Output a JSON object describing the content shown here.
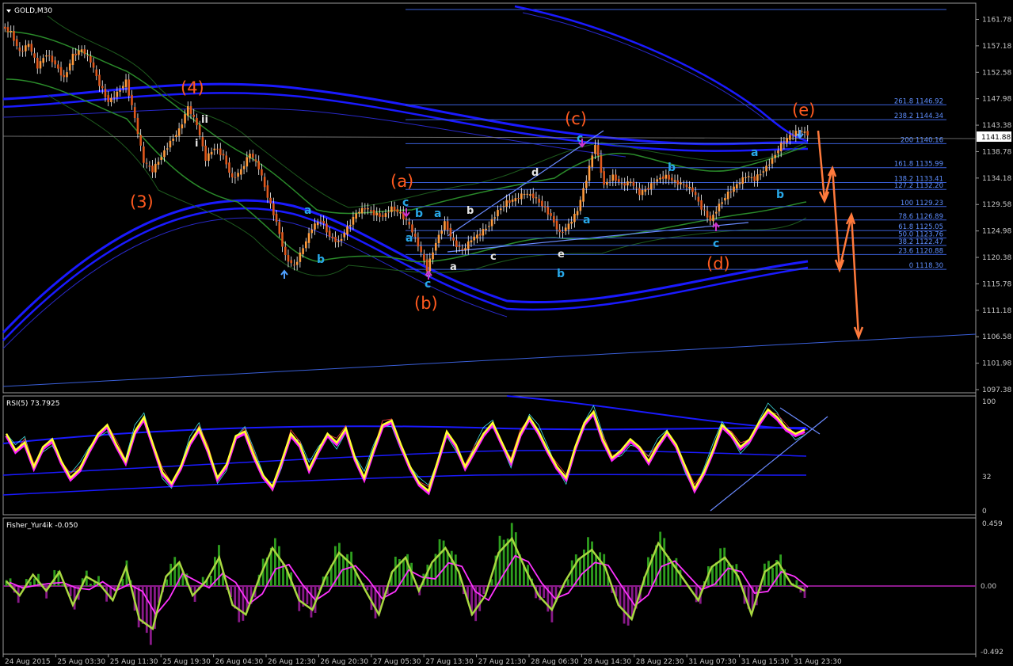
{
  "window": {
    "title": "GOLD,M30"
  },
  "indicators": {
    "rsi_title": "RSI(5) 73.7925",
    "fisher_title": "Fisher_Yur4ik -0.050"
  },
  "price_scale": [
    "1161.78",
    "1157.18",
    "1152.58",
    "1147.98",
    "1143.38",
    "1138.78",
    "1134.18",
    "1129.58",
    "1124.98",
    "1120.38",
    "1115.78",
    "1111.18",
    "1106.58",
    "1101.98",
    "1097.38"
  ],
  "current_price": "1141.88",
  "rsi_scale": [
    "100",
    "32",
    "0"
  ],
  "fisher_scale": [
    "0.459",
    "0.00",
    "-0.492"
  ],
  "time_axis": [
    "24 Aug 2015",
    "25 Aug 03:30",
    "25 Aug 11:30",
    "25 Aug 19:30",
    "26 Aug 04:30",
    "26 Aug 12:30",
    "26 Aug 20:30",
    "27 Aug 05:30",
    "27 Aug 13:30",
    "27 Aug 21:30",
    "28 Aug 06:30",
    "28 Aug 14:30",
    "28 Aug 22:30",
    "31 Aug 07:30",
    "31 Aug 15:30",
    "31 Aug 23:30"
  ],
  "fib_levels": [
    {
      "label": "261.8 1146.92",
      "price": 1146.92
    },
    {
      "label": "238.2 1144.34",
      "price": 1144.34
    },
    {
      "label": "200 1140.16",
      "price": 1140.16
    },
    {
      "label": "161.8 1135.99",
      "price": 1135.99
    },
    {
      "label": "138.2 1133.41",
      "price": 1133.41
    },
    {
      "label": "127.2 1132.20",
      "price": 1132.2
    },
    {
      "label": "100 1129.23",
      "price": 1129.23
    },
    {
      "label": "78.6 1126.89",
      "price": 1126.89
    },
    {
      "label": "61.8 1125.05",
      "price": 1125.05
    },
    {
      "label": "50.0 1123.76",
      "price": 1123.76
    },
    {
      "label": "38.2 1122.47",
      "price": 1122.47
    },
    {
      "label": "23.6 1120.88",
      "price": 1120.88
    },
    {
      "label": "0 1118.30",
      "price": 1118.3
    }
  ],
  "wave_labels": {
    "major": [
      "(4)",
      "(3)",
      "(a)",
      "(b)",
      "(c)",
      "(d)",
      "(e)"
    ],
    "minor_blue": [
      "a",
      "b",
      "c",
      "b",
      "a",
      "a",
      "c",
      "a",
      "b",
      "a",
      "b",
      "c"
    ],
    "minor_white": [
      "ii",
      "i",
      "d",
      "b",
      "a",
      "c",
      "e"
    ]
  },
  "chart_data": {
    "type": "candlestick",
    "symbol": "GOLD",
    "timeframe": "M30",
    "ylim": [
      1097.38,
      1163.5
    ],
    "key_points": [
      {
        "wave": "(4)",
        "price": 1147.0
      },
      {
        "wave": "(3)",
        "price": 1135.5
      },
      {
        "wave": "(a)",
        "price": 1128.5
      },
      {
        "wave": "(b)",
        "price": 1118.3
      },
      {
        "wave": "(c)",
        "price": 1140.2
      },
      {
        "wave": "(d)",
        "price": 1126.8
      },
      {
        "wave": "(e)",
        "price": 1142.4
      }
    ],
    "closes": [
      1159.5,
      1156.0,
      1157.5,
      1153.5,
      1155.8,
      1154.0,
      1151.5,
      1155.5,
      1156.5,
      1154.5,
      1150.5,
      1147.5,
      1149.0,
      1151.0,
      1144.5,
      1137.0,
      1135.5,
      1138.0,
      1140.5,
      1142.5,
      1146.5,
      1143.5,
      1137.5,
      1139.5,
      1138.0,
      1134.0,
      1135.5,
      1138.5,
      1136.0,
      1131.0,
      1126.5,
      1120.5,
      1118.8,
      1122.0,
      1125.5,
      1127.0,
      1124.0,
      1123.0,
      1125.5,
      1128.0,
      1129.0,
      1128.0,
      1127.5,
      1129.0,
      1128.0,
      1126.0,
      1122.5,
      1118.3,
      1123.0,
      1126.5,
      1123.0,
      1121.5,
      1123.5,
      1124.5,
      1126.0,
      1128.5,
      1130.0,
      1130.5,
      1131.5,
      1131.0,
      1129.5,
      1127.5,
      1124.5,
      1126.0,
      1128.5,
      1134.0,
      1140.2,
      1133.0,
      1134.5,
      1133.0,
      1133.5,
      1131.5,
      1132.5,
      1134.0,
      1134.5,
      1133.5,
      1133.0,
      1132.0,
      1129.0,
      1126.8,
      1129.5,
      1131.5,
      1133.0,
      1134.5,
      1134.0,
      1135.5,
      1137.5,
      1140.0,
      1141.5,
      1142.4,
      1141.9
    ],
    "rsi": {
      "name": "RSI(5)",
      "last": 73.7925,
      "ylim": [
        0,
        100
      ],
      "values": [
        70,
        55,
        62,
        40,
        58,
        65,
        45,
        30,
        38,
        55,
        70,
        78,
        60,
        45,
        72,
        85,
        60,
        35,
        25,
        40,
        62,
        75,
        55,
        30,
        42,
        68,
        72,
        50,
        32,
        22,
        45,
        70,
        60,
        38,
        55,
        70,
        62,
        75,
        48,
        30,
        55,
        78,
        82,
        60,
        40,
        25,
        18,
        45,
        72,
        60,
        40,
        55,
        70,
        80,
        62,
        45,
        70,
        85,
        72,
        55,
        40,
        30,
        58,
        80,
        90,
        65,
        48,
        55,
        65,
        58,
        45,
        60,
        72,
        60,
        40,
        20,
        35,
        55,
        78,
        70,
        58,
        65,
        80,
        92,
        85,
        75,
        70,
        73.8
      ]
    },
    "fisher": {
      "name": "Fisher_Yur4ik",
      "last": -0.05,
      "ylim": [
        -0.492,
        0.459
      ],
      "values": [
        0.05,
        -0.1,
        0.12,
        -0.05,
        0.15,
        -0.2,
        0.1,
        0.02,
        -0.15,
        0.2,
        -0.35,
        -0.45,
        0.1,
        0.25,
        -0.1,
        0.05,
        0.3,
        -0.2,
        -0.3,
        0.08,
        0.4,
        0.2,
        -0.15,
        -0.25,
        0.1,
        0.35,
        0.22,
        -0.05,
        -0.3,
        0.15,
        0.3,
        -0.05,
        0.25,
        0.4,
        0.15,
        -0.3,
        -0.1,
        0.35,
        0.5,
        0.18,
        -0.1,
        -0.25,
        0.05,
        0.28,
        0.38,
        0.2,
        -0.2,
        -0.35,
        0.1,
        0.45,
        0.25,
        0.05,
        -0.15,
        0.2,
        0.3,
        0.1,
        -0.3,
        0.15,
        0.25,
        0.02,
        -0.05
      ]
    }
  },
  "colors": {
    "background": "#000000",
    "bull_candle": "#ff9a3c",
    "bear_candle": "#ff9a3c",
    "ma_blue": "#1a1aff",
    "band_green": "#2a8a2a",
    "fib_line": "#3a5fd8",
    "wave_major": "#ff5a1f",
    "wave_minor": "#28a8e8",
    "projection": "#ff7a3c",
    "rsi_main": "#ffff33",
    "rsi_shadow": "#ff22ff",
    "fisher_pos": "#2e9e1e",
    "fisher_neg": "#8a1a8a",
    "fisher_line": "#a8d840",
    "fisher_signal": "#ff33ff"
  }
}
